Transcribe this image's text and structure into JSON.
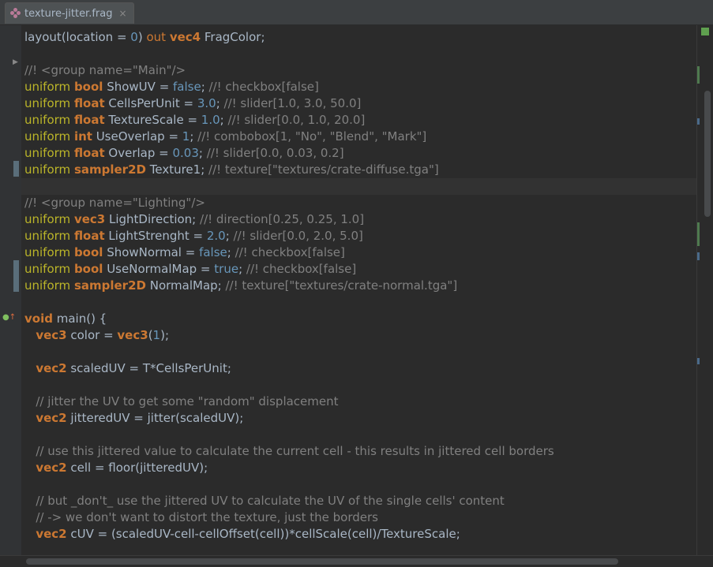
{
  "tab": {
    "filename": "texture-jitter.frag",
    "close_glyph": "×",
    "icon": "shader-file-icon"
  },
  "code_lines": [
    [
      [
        "plain",
        "layout"
      ],
      [
        "plain",
        "(location = "
      ],
      [
        "num",
        "0"
      ],
      [
        "plain",
        ") "
      ],
      [
        "kw-y",
        "out "
      ],
      [
        "type",
        "vec4"
      ],
      [
        "plain",
        " FragColor;"
      ]
    ],
    [],
    [
      [
        "cmt",
        "//! <group name=\"Main\"/>"
      ]
    ],
    [
      [
        "kw-u",
        "uniform "
      ],
      [
        "type",
        "bool"
      ],
      [
        "plain",
        " ShowUV = "
      ],
      [
        "num",
        "false"
      ],
      [
        "plain",
        "; "
      ],
      [
        "cmt",
        "//! checkbox[false]"
      ]
    ],
    [
      [
        "kw-u",
        "uniform "
      ],
      [
        "type",
        "float"
      ],
      [
        "plain",
        " CellsPerUnit = "
      ],
      [
        "num",
        "3.0"
      ],
      [
        "plain",
        "; "
      ],
      [
        "cmt",
        "//! slider[1.0, 3.0, 50.0]"
      ]
    ],
    [
      [
        "kw-u",
        "uniform "
      ],
      [
        "type",
        "float"
      ],
      [
        "plain",
        " TextureScale = "
      ],
      [
        "num",
        "1.0"
      ],
      [
        "plain",
        "; "
      ],
      [
        "cmt",
        "//! slider[0.0, 1.0, 20.0]"
      ]
    ],
    [
      [
        "kw-u",
        "uniform "
      ],
      [
        "type",
        "int"
      ],
      [
        "plain",
        " UseOverlap = "
      ],
      [
        "num",
        "1"
      ],
      [
        "plain",
        "; "
      ],
      [
        "cmt",
        "//! combobox[1, \"No\", \"Blend\", \"Mark\"]"
      ]
    ],
    [
      [
        "kw-u",
        "uniform "
      ],
      [
        "type",
        "float"
      ],
      [
        "plain",
        " Overlap = "
      ],
      [
        "num",
        "0.03"
      ],
      [
        "plain",
        "; "
      ],
      [
        "cmt",
        "//! slider[0.0, 0.03, 0.2]"
      ]
    ],
    [
      [
        "kw-u",
        "uniform "
      ],
      [
        "type",
        "sampler2D"
      ],
      [
        "plain",
        " Texture1; "
      ],
      [
        "cmt",
        "//! texture[\"textures/crate-diffuse.tga\"]"
      ]
    ],
    [],
    [
      [
        "cmt",
        "//! <group name=\"Lighting\"/>"
      ]
    ],
    [
      [
        "kw-u",
        "uniform "
      ],
      [
        "type",
        "vec3"
      ],
      [
        "plain",
        " LightDirection; "
      ],
      [
        "cmt",
        "//! direction[0.25, 0.25, 1.0]"
      ]
    ],
    [
      [
        "kw-u",
        "uniform "
      ],
      [
        "type",
        "float"
      ],
      [
        "plain",
        " LightStrenght = "
      ],
      [
        "num",
        "2.0"
      ],
      [
        "plain",
        "; "
      ],
      [
        "cmt",
        "//! slider[0.0, 2.0, 5.0]"
      ]
    ],
    [
      [
        "kw-u",
        "uniform "
      ],
      [
        "type",
        "bool"
      ],
      [
        "plain",
        " ShowNormal = "
      ],
      [
        "num",
        "false"
      ],
      [
        "plain",
        "; "
      ],
      [
        "cmt",
        "//! checkbox[false]"
      ]
    ],
    [
      [
        "kw-u",
        "uniform "
      ],
      [
        "type",
        "bool"
      ],
      [
        "plain",
        " UseNormalMap = "
      ],
      [
        "num",
        "true"
      ],
      [
        "plain",
        "; "
      ],
      [
        "cmt",
        "//! checkbox[false]"
      ]
    ],
    [
      [
        "kw-u",
        "uniform "
      ],
      [
        "type",
        "sampler2D"
      ],
      [
        "plain",
        " NormalMap; "
      ],
      [
        "cmt",
        "//! texture[\"textures/crate-normal.tga\"]"
      ]
    ],
    [],
    [
      [
        "type",
        "void"
      ],
      [
        "plain",
        " main() {"
      ]
    ],
    [
      [
        "plain",
        "   "
      ],
      [
        "type",
        "vec3"
      ],
      [
        "plain",
        " color = "
      ],
      [
        "type",
        "vec3"
      ],
      [
        "plain",
        "("
      ],
      [
        "num",
        "1"
      ],
      [
        "plain",
        ");"
      ]
    ],
    [],
    [
      [
        "plain",
        "   "
      ],
      [
        "type",
        "vec2"
      ],
      [
        "plain",
        " scaledUV = T*CellsPerUnit;"
      ]
    ],
    [],
    [
      [
        "plain",
        "   "
      ],
      [
        "cmt",
        "// jitter the UV to get some \"random\" displacement"
      ]
    ],
    [
      [
        "plain",
        "   "
      ],
      [
        "type",
        "vec2"
      ],
      [
        "plain",
        " jitteredUV = jitter(scaledUV);"
      ]
    ],
    [],
    [
      [
        "plain",
        "   "
      ],
      [
        "cmt",
        "// use this jittered value to calculate the current cell - this results in jittered cell borders"
      ]
    ],
    [
      [
        "plain",
        "   "
      ],
      [
        "type",
        "vec2"
      ],
      [
        "plain",
        " cell = floor(jitteredUV);"
      ]
    ],
    [],
    [
      [
        "plain",
        "   "
      ],
      [
        "cmt",
        "// but _don't_ use the jittered UV to calculate the UV of the single cells' content"
      ]
    ],
    [
      [
        "plain",
        "   "
      ],
      [
        "cmt",
        "// -> we don't want to distort the texture, just the borders"
      ]
    ],
    [
      [
        "plain",
        "   "
      ],
      [
        "type",
        "vec2"
      ],
      [
        "plain",
        " cUV = (scaledUV-cell-cellOffset(cell))*cellScale(cell)/TextureScale;"
      ]
    ]
  ],
  "current_line_index": 9,
  "gutter": {
    "fold_icon": "fold-arrow-icon",
    "debug_icon": "breakpoint-override-icon"
  },
  "colors": {
    "keyword": "#cc7832",
    "uniform": "#bbb529",
    "number": "#6897bb",
    "comment": "#808080",
    "text": "#a9b7c6",
    "background": "#2b2b2b"
  }
}
